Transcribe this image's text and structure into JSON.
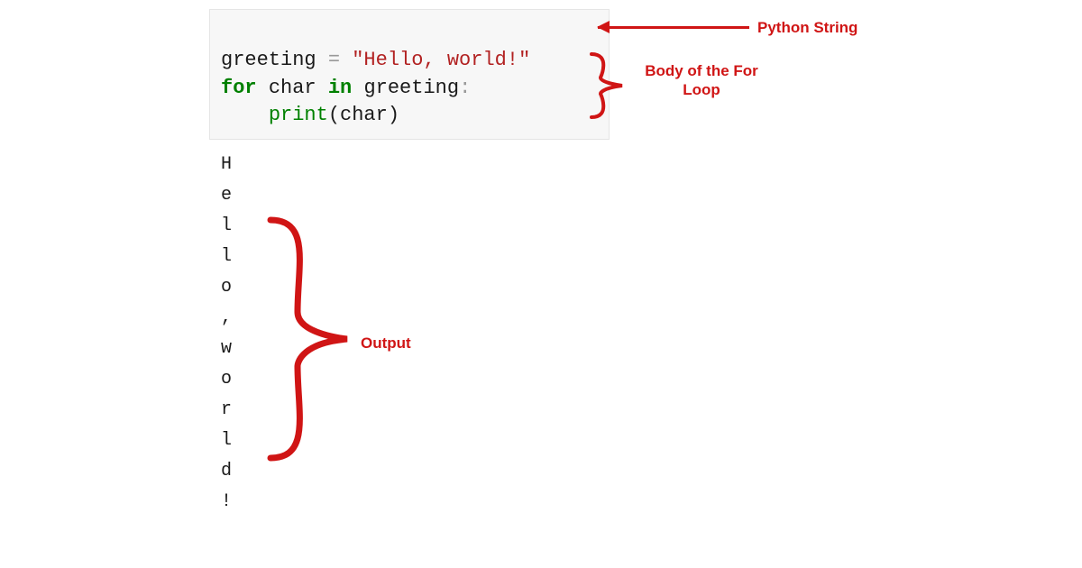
{
  "code": {
    "line1": {
      "var": "greeting",
      "sp1": " ",
      "op": "=",
      "sp2": " ",
      "str": "\"Hello, world!\""
    },
    "line2": {
      "kw1": "for",
      "sp1": " ",
      "var1": "char",
      "sp2": " ",
      "kw2": "in",
      "sp3": " ",
      "var2": "greeting",
      "colon": ":"
    },
    "line3": {
      "indent": "    ",
      "func": "print",
      "lp": "(",
      "arg": "char",
      "rp": ")"
    }
  },
  "output": {
    "c0": "H",
    "c1": "e",
    "c2": "l",
    "c3": "l",
    "c4": "o",
    "c5": ",",
    "c6": " ",
    "c7": "w",
    "c8": "o",
    "c9": "r",
    "c10": "l",
    "c11": "d",
    "c12": "!"
  },
  "annotations": {
    "string": "Python String",
    "loop": "Body of the For Loop",
    "output": "Output"
  },
  "colors": {
    "annotation": "#d01515",
    "code_bg": "#f7f7f7"
  }
}
